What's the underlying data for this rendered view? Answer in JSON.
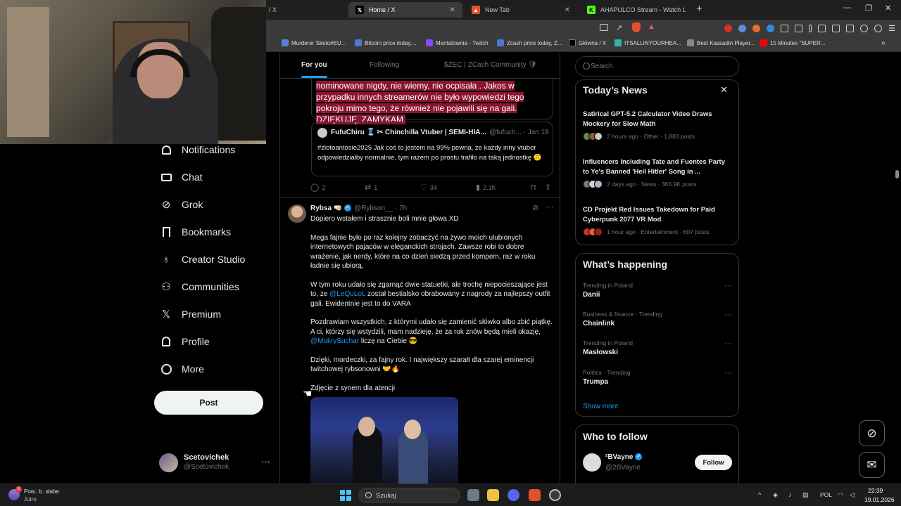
{
  "browser": {
    "tabs": [
      {
        "label": "/ X",
        "active": false
      },
      {
        "label": "Home / X",
        "active": true
      },
      {
        "label": "New Tab",
        "active": false
      },
      {
        "label": "AHAPULCO Stream - Watch Live on K",
        "active": false
      }
    ],
    "bookmarks": [
      "Murderer Sketo#EU...",
      "Bitcoin price today,...",
      "Mentalownia - Twitch",
      "Zcash price today, Z...",
      "Główna / X",
      "ITSALLINYOURHEA...",
      "Best Kassadin Player...",
      "15 Minutes \"SUPER..."
    ]
  },
  "nav": {
    "items": [
      "Notifications",
      "Chat",
      "Grok",
      "Bookmarks",
      "Creator Studio",
      "Communities",
      "Premium",
      "Profile",
      "More"
    ],
    "post_label": "Post",
    "account_name": "Scetovichek",
    "account_handle": "@Scetovichek"
  },
  "feed": {
    "tabs": [
      "For you",
      "Following",
      "$ZEC | ZCash Community 🛡"
    ],
    "quoted_highlight": "nominowane nigdy, nie wiemy, nie ocpisała . Jakos w przypadku innych streamerów nie było wypowiedzi tego pokroju mimo tego, że również nie pojawili się na gali. DZIĘKUJĘ, ZAMYKAM.",
    "nested_quote": {
      "name": "FufuChiru 🧵 ✂ Chinchilla Vtuber | SEMI-HIA...",
      "handle": "@fufuch... · Jan 18",
      "text": "#zlotoantosie2025 Jak coś to jestem na 99% pewna, że każdy inny vtuber odpowiedziałby normalnie, tym razem po prostu trafiło na taką jednostkę 🙃"
    },
    "actions": {
      "replies": "2",
      "reposts": "1",
      "likes": "34",
      "views": "2.1K"
    },
    "post": {
      "name": "Rybsa 🤜🏻",
      "handle": "@Rybson__ · 7h",
      "line1": "Dopiero wstałem i strasznie boli mnie głowa XD",
      "para1": "Mega fajnie było po raz kolejny zobaczyć na żywo moich ulubionych internetowych pajaców w eleganckich strojach. Zawsze robi to dobre wrażenie, jak nerdy, które na co dzień siedzą przed kompem, raz w roku ładnie się ubiorą.",
      "para2_before": "W tym roku udało się zgarnąć dwie statuetki, ale trochę niepocieszające jest to, że ",
      "para2_mention": "@LeQuLoL",
      "para2_after": " został bestialsko obrabowany z nagrody za najlepszy outfit gali. Ewidentnie jest to do VARA",
      "para3_before": "Pozdrawiam wszystkich, z którymi udało się zamienić słówko albo zbić piątkę. A ci, którzy się wstydzili, mam nadzieję, że za rok znów będą mieli okazję, ",
      "para3_mention": "@MokrySuchar",
      "para3_after": " liczę na Ciebie 😎",
      "para4": "Dzięki, mordeczki, za fajny rok. I największy szarałt dla szarej eminencji twitchowej rybsonowni 🤝🔥",
      "caption": "Zdjęcie z synem dla atencji"
    }
  },
  "right": {
    "search_placeholder": "Search",
    "news_title": "Today’s News",
    "news": [
      {
        "title": "Satirical GPT-5.2 Calculator Video Draws Mockery for Slow Math",
        "meta": "2 hours ago · Other · 1,883 posts"
      },
      {
        "title": "Influencers Including Tate and Fuentes Party to Ye's Banned 'Heil Hitler' Song in ...",
        "meta": "2 days ago · News · 363.9K posts"
      },
      {
        "title": "CD Projekt Red Issues Takedown for Paid Cyberpunk 2077 VR Mod",
        "meta": "1 hour ago · Entertainment · 607 posts"
      }
    ],
    "happening_title": "What’s happening",
    "trends": [
      {
        "meta": "Trending in Poland",
        "name": "Danii"
      },
      {
        "meta": "Business & finance · Trending",
        "name": "Chainlink"
      },
      {
        "meta": "Trending in Poland",
        "name": "Masłowski"
      },
      {
        "meta": "Politics · Trending",
        "name": "Trumpa"
      }
    ],
    "show_more": "Show more",
    "who_title": "Who to follow",
    "follow": {
      "name": "²BVayne",
      "handle": "@2BVayne",
      "button": "Follow"
    }
  },
  "taskbar": {
    "weather_line1": "Pow.: b. słabe",
    "weather_line2": "Jutro",
    "weather_badge": "2",
    "search_label": "Szukaj",
    "lang": "POL",
    "time": "22:39",
    "date": "19.01.2026"
  },
  "colors": {
    "accent": "#1d9bf0",
    "highlight": "#8b1531",
    "background": "#000000"
  }
}
